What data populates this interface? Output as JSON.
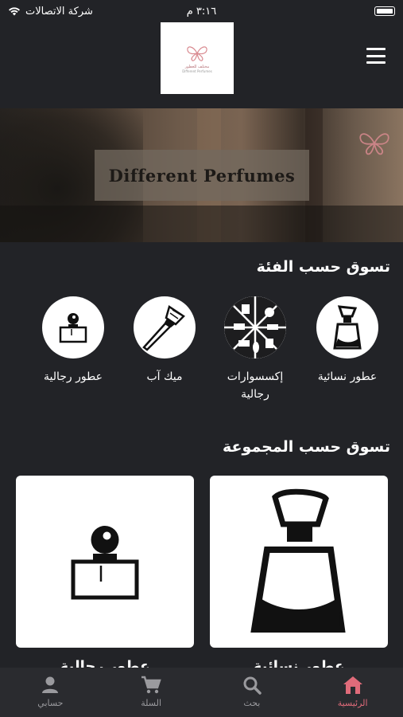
{
  "status": {
    "carrier": "شركة الاتصالات",
    "time": "٣:١٦ م"
  },
  "header": {
    "logo_text": "مختلف للعطور",
    "logo_subtext": "Different Perfumes"
  },
  "hero": {
    "label": "Different Perfumes"
  },
  "categories": {
    "title": "تسوق حسب الفئة",
    "items": [
      {
        "label": "عطور نسائية",
        "icon": "women-perfume-icon"
      },
      {
        "label": "إكسسوارات رجالية",
        "icon": "men-accessories-icon"
      },
      {
        "label": "ميك آب",
        "icon": "makeup-brush-icon"
      },
      {
        "label": "عطور رجالية",
        "icon": "men-perfume-icon"
      }
    ]
  },
  "collections": {
    "title": "تسوق حسب المجموعة",
    "items": [
      {
        "label": "عطور نسائية",
        "icon": "women-perfume-icon"
      },
      {
        "label": "عطور رجالية",
        "icon": "men-perfume-icon"
      }
    ]
  },
  "bottom_nav": {
    "items": [
      {
        "label": "الرئيسية",
        "icon": "home-icon",
        "active": true
      },
      {
        "label": "بحث",
        "icon": "search-icon",
        "active": false
      },
      {
        "label": "السلة",
        "icon": "cart-icon",
        "active": false
      },
      {
        "label": "حسابي",
        "icon": "account-icon",
        "active": false
      }
    ],
    "active_color": "#e06b7a",
    "inactive_color": "#9a9a9e"
  }
}
